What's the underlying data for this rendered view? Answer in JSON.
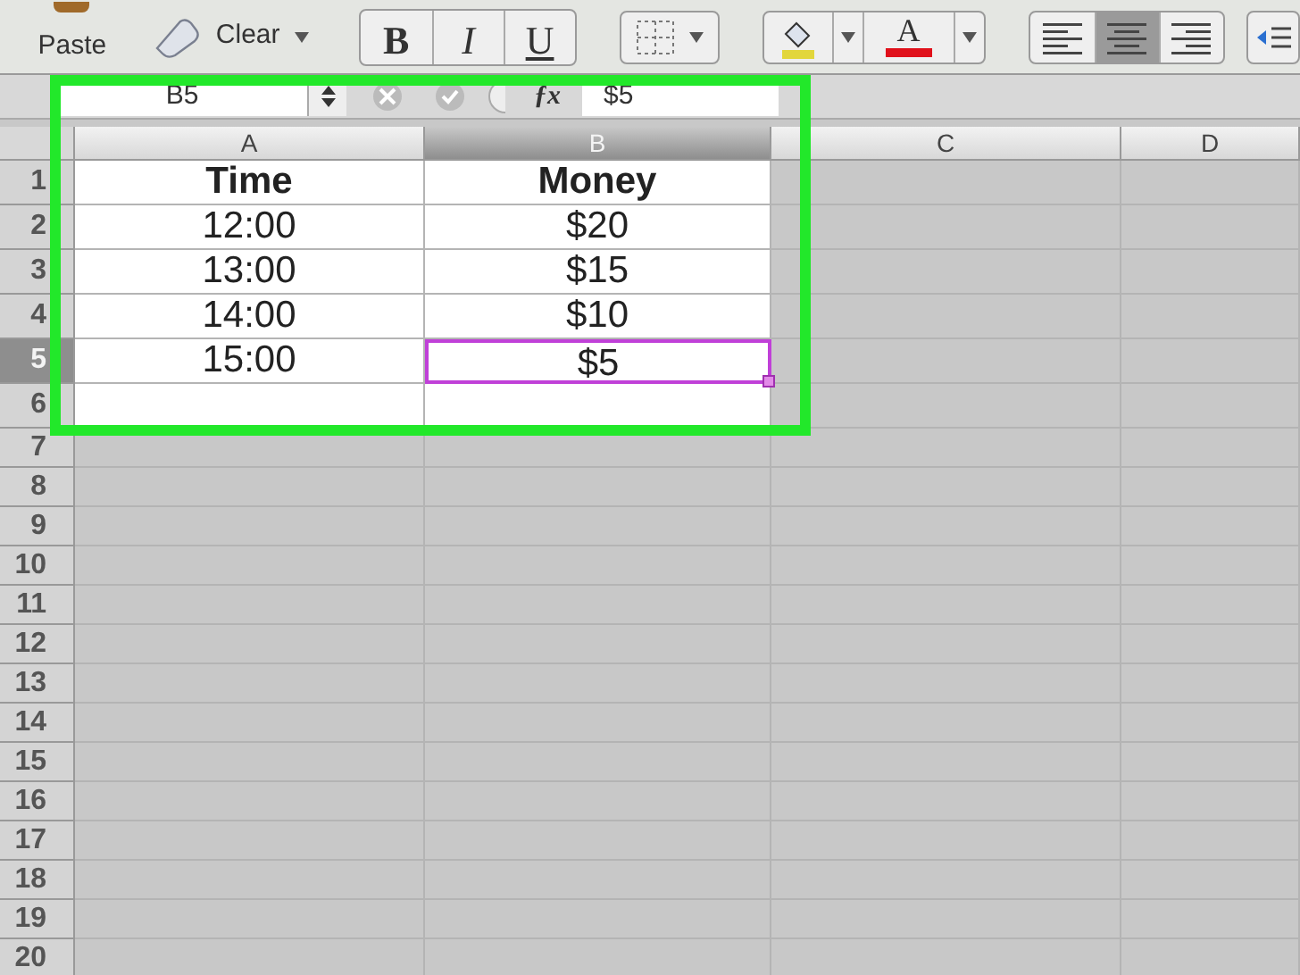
{
  "toolbar": {
    "paste": "Paste",
    "clear": "Clear",
    "format_buttons": [
      "B",
      "I",
      "U"
    ],
    "font_color": "A",
    "align_buttons": [
      {
        "kind": "left",
        "selected": false
      },
      {
        "kind": "center",
        "selected": true
      },
      {
        "kind": "right",
        "selected": false
      }
    ]
  },
  "formula_bar": {
    "name_box": "B5",
    "function_label": "ƒx",
    "formula": "$5"
  },
  "columns": [
    {
      "label": "A",
      "selected": false
    },
    {
      "label": "B",
      "selected": true
    },
    {
      "label": "C",
      "selected": false
    },
    {
      "label": "D",
      "selected": false
    }
  ],
  "rows": [
    {
      "number": "1",
      "selected": false,
      "cells": [
        {
          "text": "Time",
          "bold": true
        },
        {
          "text": "Money",
          "bold": true
        }
      ]
    },
    {
      "number": "2",
      "selected": false,
      "cells": [
        {
          "text": "12:00",
          "bold": false
        },
        {
          "text": "$20",
          "bold": false
        }
      ]
    },
    {
      "number": "3",
      "selected": false,
      "cells": [
        {
          "text": "13:00",
          "bold": false
        },
        {
          "text": "$15",
          "bold": false
        }
      ]
    },
    {
      "number": "4",
      "selected": false,
      "cells": [
        {
          "text": "14:00",
          "bold": false
        },
        {
          "text": "$10",
          "bold": false
        }
      ]
    },
    {
      "number": "5",
      "selected": true,
      "cells": [
        {
          "text": "15:00",
          "bold": false
        },
        {
          "text": "$5",
          "bold": false
        }
      ]
    },
    {
      "number": "6",
      "selected": false,
      "cells": []
    },
    {
      "number": "7",
      "selected": false,
      "cells": []
    },
    {
      "number": "8",
      "selected": false,
      "cells": []
    },
    {
      "number": "9",
      "selected": false,
      "cells": []
    },
    {
      "number": "10",
      "selected": false,
      "cells": []
    },
    {
      "number": "11",
      "selected": false,
      "cells": []
    },
    {
      "number": "12",
      "selected": false,
      "cells": []
    },
    {
      "number": "13",
      "selected": false,
      "cells": []
    },
    {
      "number": "14",
      "selected": false,
      "cells": []
    },
    {
      "number": "15",
      "selected": false,
      "cells": []
    },
    {
      "number": "16",
      "selected": false,
      "cells": []
    },
    {
      "number": "17",
      "selected": false,
      "cells": []
    },
    {
      "number": "18",
      "selected": false,
      "cells": []
    },
    {
      "number": "19",
      "selected": false,
      "cells": []
    },
    {
      "number": "20",
      "selected": false,
      "cells": []
    }
  ]
}
